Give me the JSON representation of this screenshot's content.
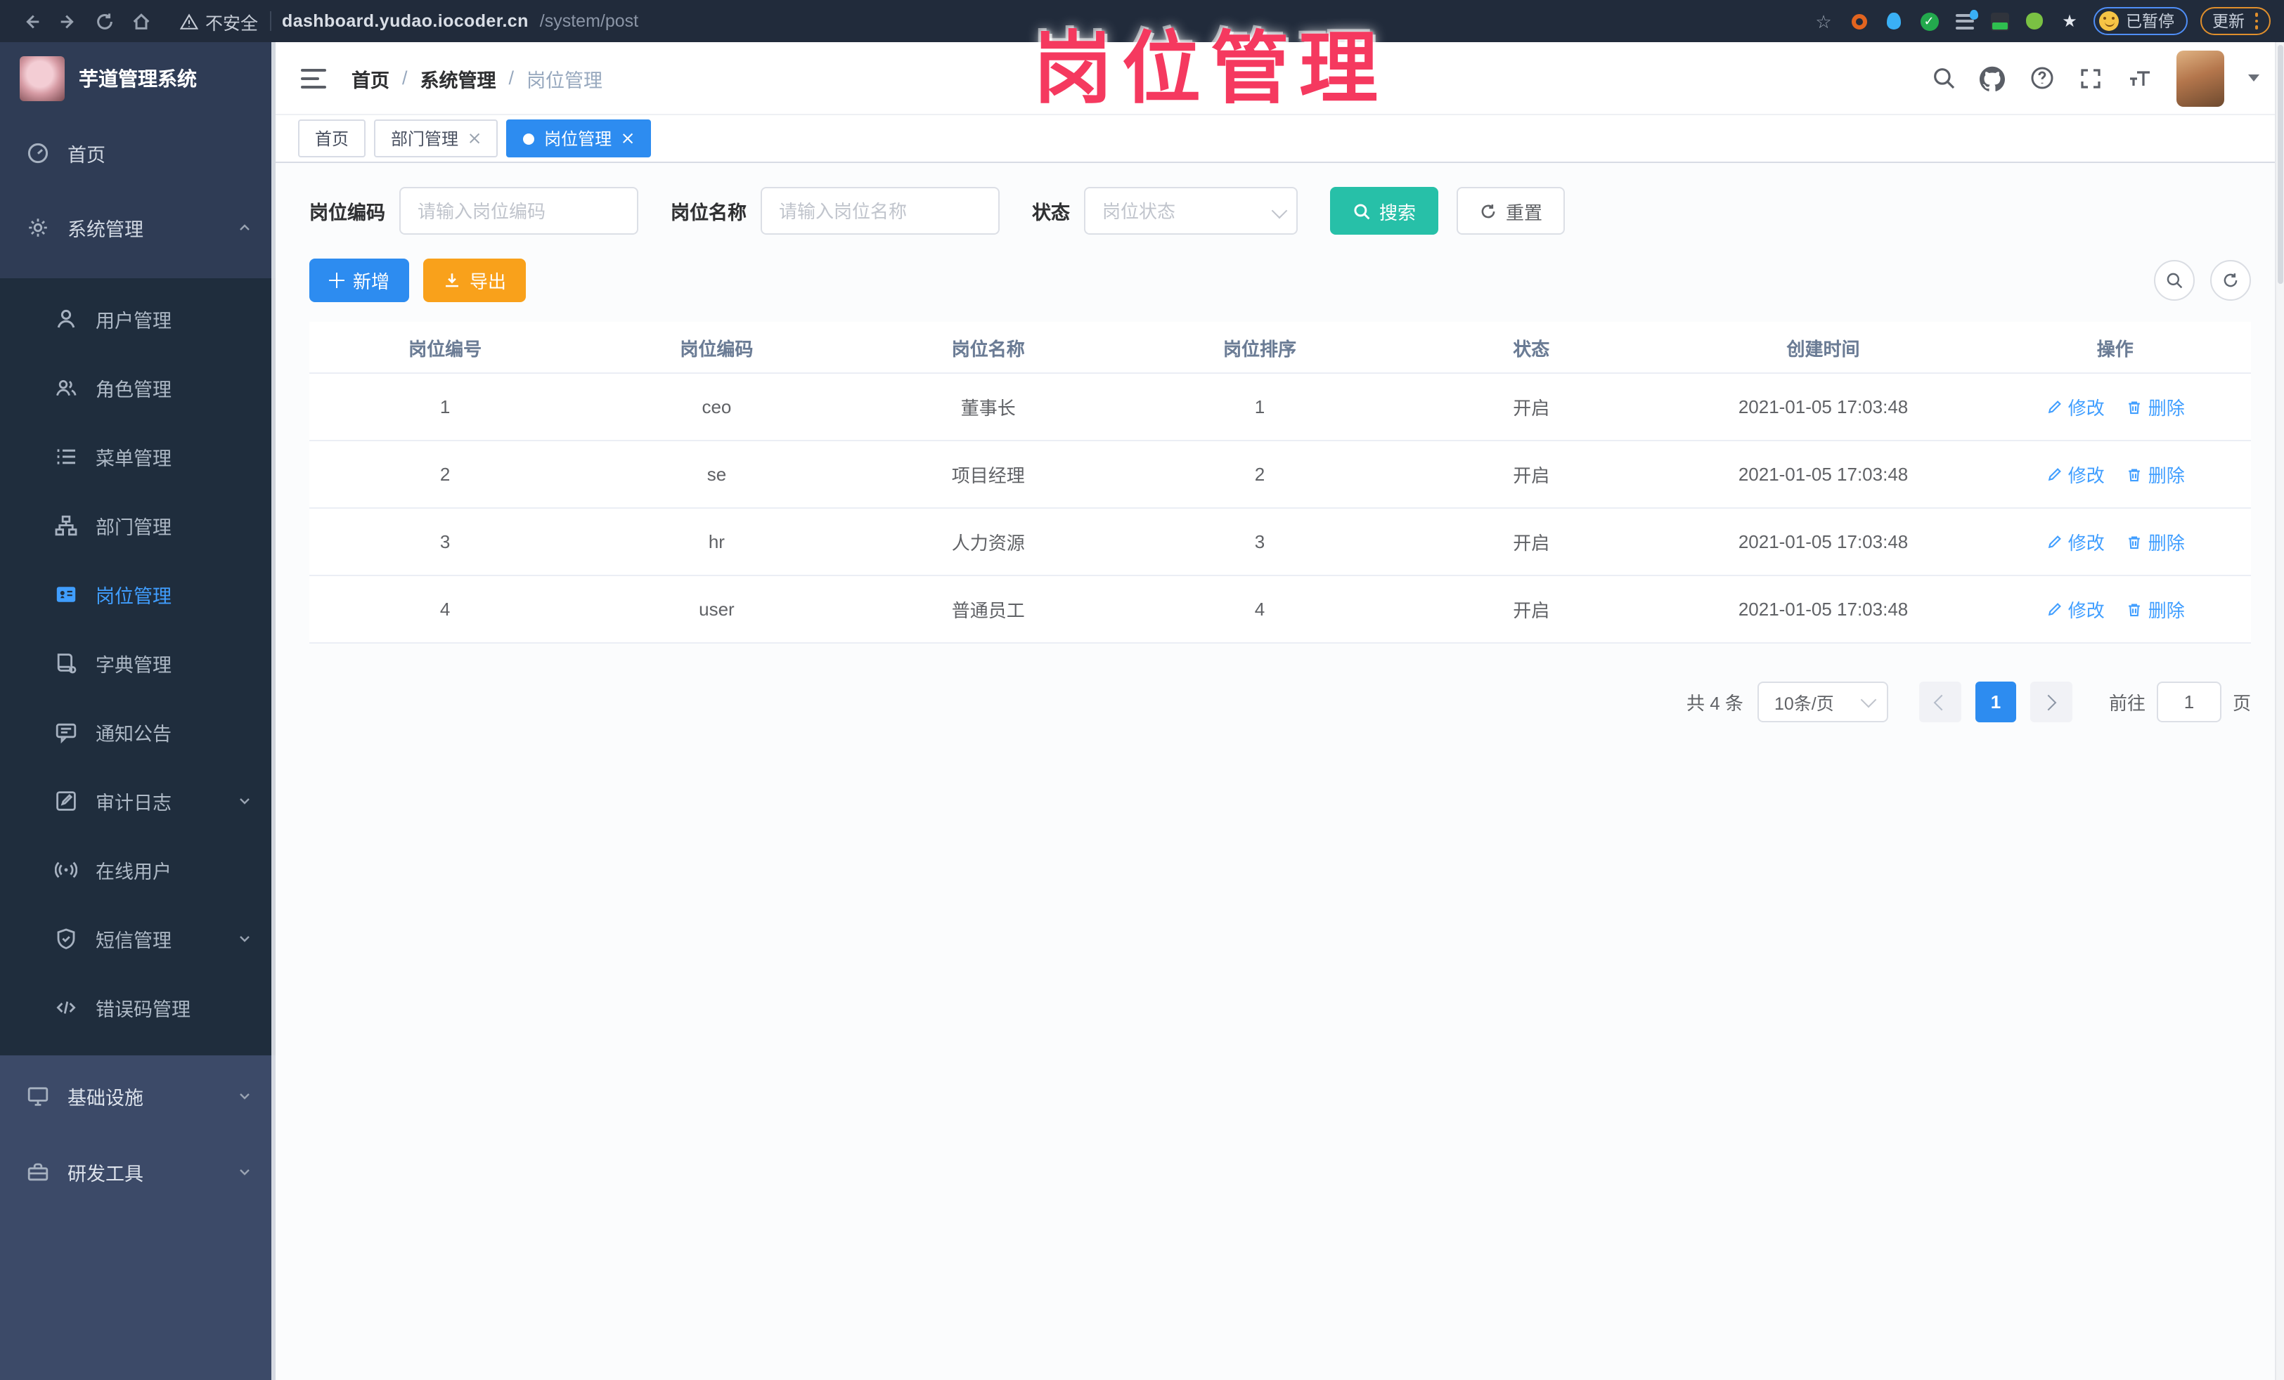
{
  "colors": {
    "primary": "#2d8cf0",
    "link_blue": "#409eff",
    "search_button_teal": "#27c0a8",
    "export_button_orange": "#f9a11b",
    "annotation_pink": "#f5395f",
    "sidebar_bg": "#2f3c55",
    "sidebar_submenu_bg": "#1f2d3d",
    "sidebar_bottom_bg": "#3c4a68"
  },
  "browser": {
    "security_label": "不安全",
    "url_host": "dashboard.yudao.iocoder.cn",
    "url_path": "/system/post",
    "paused_label": "已暂停",
    "update_label": "更新"
  },
  "overlay": {
    "title": "岗位管理"
  },
  "sidebar": {
    "app_title": "芋道管理系统",
    "top_items": [
      {
        "label": "首页",
        "icon": "dashboard-icon"
      },
      {
        "label": "系统管理",
        "icon": "gear-icon",
        "state": "expanded"
      }
    ],
    "sub_items": [
      {
        "label": "用户管理",
        "icon": "user-icon"
      },
      {
        "label": "角色管理",
        "icon": "users-icon"
      },
      {
        "label": "菜单管理",
        "icon": "menu-list-icon"
      },
      {
        "label": "部门管理",
        "icon": "org-tree-icon"
      },
      {
        "label": "岗位管理",
        "icon": "badge-icon",
        "active": true
      },
      {
        "label": "字典管理",
        "icon": "dictionary-icon"
      },
      {
        "label": "通知公告",
        "icon": "announcement-icon"
      },
      {
        "label": "审计日志",
        "icon": "audit-log-icon",
        "state": "collapsed"
      },
      {
        "label": "在线用户",
        "icon": "online-users-icon"
      },
      {
        "label": "短信管理",
        "icon": "sms-shield-icon",
        "state": "collapsed"
      },
      {
        "label": "错误码管理",
        "icon": "error-code-icon"
      }
    ],
    "bottom_items": [
      {
        "label": "基础设施",
        "icon": "infrastructure-icon",
        "state": "collapsed"
      },
      {
        "label": "研发工具",
        "icon": "dev-tools-icon",
        "state": "collapsed"
      }
    ]
  },
  "navbar": {
    "breadcrumb": [
      "首页",
      "系统管理",
      "岗位管理"
    ],
    "separator": "/"
  },
  "tabs": [
    {
      "label": "首页",
      "closable": false,
      "active": false
    },
    {
      "label": "部门管理",
      "closable": true,
      "active": false
    },
    {
      "label": "岗位管理",
      "closable": true,
      "active": true
    }
  ],
  "filter": {
    "code_label": "岗位编码",
    "code_placeholder": "请输入岗位编码",
    "name_label": "岗位名称",
    "name_placeholder": "请输入岗位名称",
    "status_label": "状态",
    "status_placeholder": "岗位状态",
    "search_label": "搜索",
    "reset_label": "重置"
  },
  "toolbar": {
    "add_label": "新增",
    "export_label": "导出"
  },
  "table": {
    "headers": [
      "岗位编号",
      "岗位编码",
      "岗位名称",
      "岗位排序",
      "状态",
      "创建时间",
      "操作"
    ],
    "edit_label": "修改",
    "delete_label": "删除",
    "rows": [
      {
        "id": "1",
        "code": "ceo",
        "name": "董事长",
        "sort": "1",
        "status": "开启",
        "created": "2021-01-05 17:03:48"
      },
      {
        "id": "2",
        "code": "se",
        "name": "项目经理",
        "sort": "2",
        "status": "开启",
        "created": "2021-01-05 17:03:48"
      },
      {
        "id": "3",
        "code": "hr",
        "name": "人力资源",
        "sort": "3",
        "status": "开启",
        "created": "2021-01-05 17:03:48"
      },
      {
        "id": "4",
        "code": "user",
        "name": "普通员工",
        "sort": "4",
        "status": "开启",
        "created": "2021-01-05 17:03:48"
      }
    ]
  },
  "pagination": {
    "total_label": "共 4 条",
    "page_size_label": "10条/页",
    "current_page": "1",
    "goto_label": "前往",
    "goto_value": "1",
    "page_unit_label": "页"
  }
}
